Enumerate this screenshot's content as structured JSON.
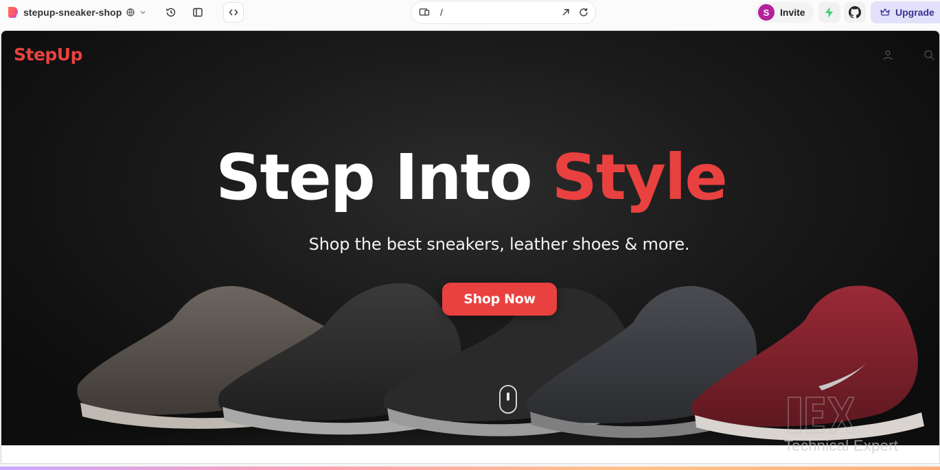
{
  "toolbar": {
    "project_name": "stepup-sneaker-shop",
    "url_path": "/",
    "invite": {
      "avatar_initial": "S",
      "label": "Invite"
    },
    "upgrade_label": "Upgrade",
    "icons": [
      "app-logo-icon",
      "globe-icon",
      "chevron-down-icon",
      "history-icon",
      "sidebar-toggle-icon",
      "code-icon",
      "device-preview-icon",
      "open-external-icon",
      "refresh-icon",
      "bolt-icon",
      "github-icon",
      "crown-icon"
    ],
    "colors": {
      "avatar": "#b3229b",
      "bolt": "#3ecf6e",
      "upgrade_bg": "#e3e0fb"
    }
  },
  "site": {
    "brand": "StepUp",
    "headline": {
      "part1": "Step Into ",
      "part2": "Style"
    },
    "subheadline": "Shop the best sneakers, leather shoes & more.",
    "cta_label": "Shop Now",
    "colors": {
      "accent": "#e9413f",
      "hero_bg": "#141414"
    }
  },
  "watermark": {
    "text": "Technical Expert"
  }
}
